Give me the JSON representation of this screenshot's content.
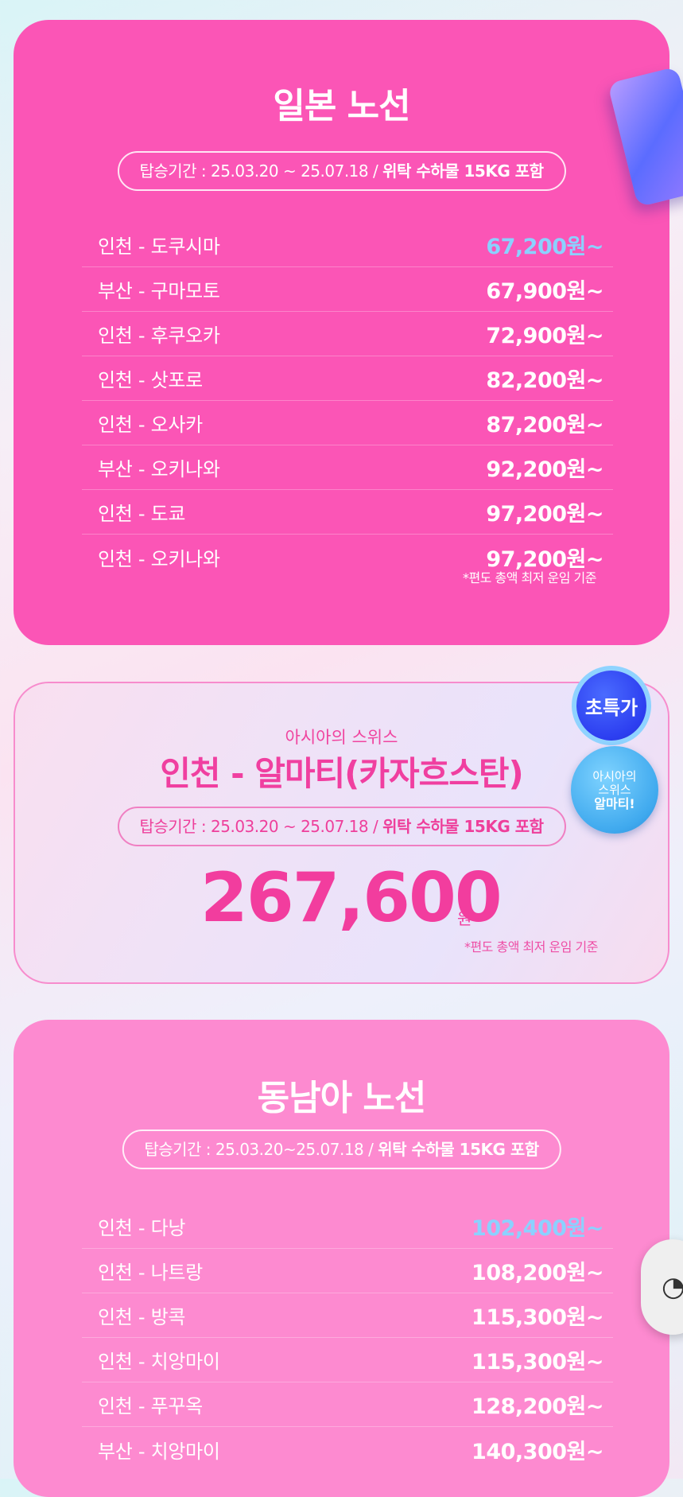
{
  "japan": {
    "title": "일본 노선",
    "period_prefix": "탑승기간 : 25.03.20 ~ 25.07.18 / ",
    "period_strong": "위탁 수하물 15KG 포함",
    "routes": [
      {
        "route": "인천 - 도쿠시마",
        "price": "67,200원~"
      },
      {
        "route": "부산 - 구마모토",
        "price": "67,900원~"
      },
      {
        "route": "인천 - 후쿠오카",
        "price": "72,900원~"
      },
      {
        "route": "인천 - 삿포로",
        "price": "82,200원~"
      },
      {
        "route": "인천 - 오사카",
        "price": "87,200원~"
      },
      {
        "route": "부산 - 오키나와",
        "price": "92,200원~"
      },
      {
        "route": "인천 - 도쿄",
        "price": "97,200원~"
      },
      {
        "route": "인천 - 오키나와",
        "price": "97,200원~"
      }
    ],
    "note": "*편도 총액 최저 운임 기준"
  },
  "special": {
    "subtitle": "아시아의 스위스",
    "title": "인천 - 알마티(카자흐스탄)",
    "period_prefix": "탑승기간 : 25.03.20 ~ 25.07.18 / ",
    "period_strong": "위탁 수하물 15KG 포함",
    "price": "267,600",
    "unit": "원~",
    "note": "*편도 총액 최저 운임 기준",
    "badge_special": "초특가",
    "badge_line1": "아시아의",
    "badge_line2": "스위스",
    "badge_line3": "알마티!"
  },
  "sea": {
    "title": "동남아 노선",
    "period_prefix": "탑승기간 : 25.03.20~25.07.18 / ",
    "period_strong": "위탁 수하물 15KG 포함",
    "routes": [
      {
        "route": "인천 - 다낭",
        "price": "102,400원~"
      },
      {
        "route": "인천 - 나트랑",
        "price": "108,200원~"
      },
      {
        "route": "인천 - 방콕",
        "price": "115,300원~"
      },
      {
        "route": "인천 - 치앙마이",
        "price": "115,300원~"
      },
      {
        "route": "인천 - 푸꾸옥",
        "price": "128,200원~"
      },
      {
        "route": "부산 - 치앙마이",
        "price": "140,300원~"
      }
    ]
  },
  "colors": {
    "highlight_price": "#8bd1ff",
    "japan_bg": "#fb55b6",
    "sea_bg": "#fd8ad0"
  },
  "icons": {
    "suitcase": "suitcase-icon",
    "floating": "chat-icon"
  }
}
